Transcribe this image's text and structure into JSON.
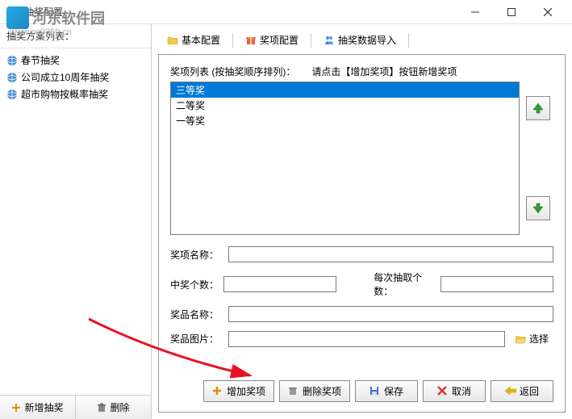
{
  "window": {
    "title": "抽奖配置"
  },
  "watermark": {
    "site_name": "河东软件园",
    "url": "www.pc0359.cn"
  },
  "sidebar": {
    "header": "抽奖方案列表：",
    "items": [
      {
        "label": "春节抽奖"
      },
      {
        "label": "公司成立10周年抽奖"
      },
      {
        "label": "超市购物按概率抽奖"
      }
    ],
    "footer": {
      "add": "新增抽奖",
      "delete": "删除"
    }
  },
  "tabs": [
    {
      "label": "基本配置",
      "icon": "folder-icon"
    },
    {
      "label": "奖项配置",
      "icon": "prize-icon"
    },
    {
      "label": "抽奖数据导入",
      "icon": "people-icon"
    }
  ],
  "panel": {
    "list_label": "奖项列表 (按抽奖顺序排列)：",
    "list_hint": "请点击【增加奖项】按钮新增奖项",
    "items": [
      {
        "label": "三等奖",
        "selected": true
      },
      {
        "label": "二等奖",
        "selected": false
      },
      {
        "label": "一等奖",
        "selected": false
      }
    ],
    "form": {
      "name_label": "奖项名称：",
      "name_value": "",
      "count_label": "中奖个数：",
      "count_value": "",
      "per_draw_label": "每次抽取个数：",
      "per_draw_value": "",
      "prize_name_label": "奖品名称：",
      "prize_name_value": "",
      "image_label": "奖品图片：",
      "image_value": "",
      "browse_label": "选择"
    },
    "actions": {
      "add": "增加奖项",
      "delete": "删除奖项",
      "save": "保存",
      "cancel": "取消",
      "back": "返回"
    }
  }
}
